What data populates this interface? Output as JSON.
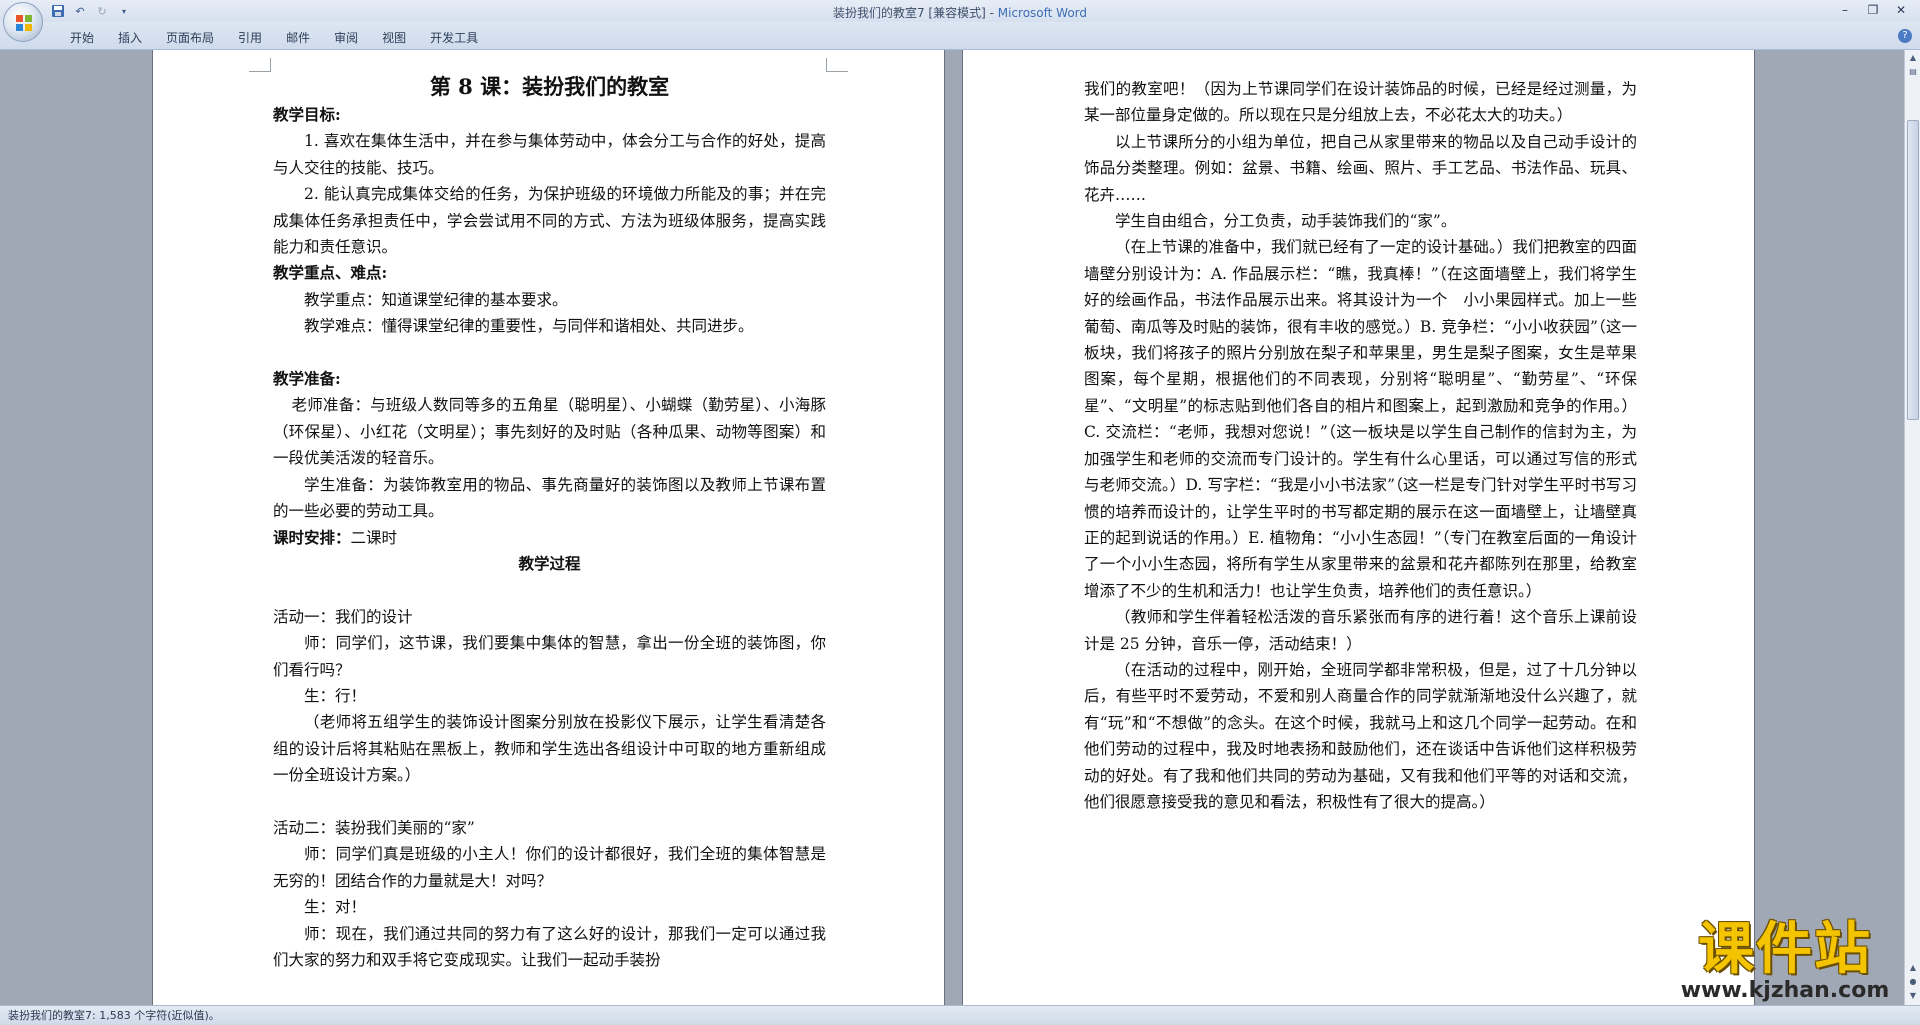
{
  "window": {
    "title_doc": "装扮我们的教室7 [兼容模式] - ",
    "title_app": "Microsoft Word"
  },
  "ribbon": {
    "tabs": [
      "开始",
      "插入",
      "页面布局",
      "引用",
      "邮件",
      "审阅",
      "视图",
      "开发工具"
    ]
  },
  "page1": {
    "title": "第 8 课：装扮我们的教室",
    "paragraphs": [
      {
        "style": "h",
        "text": "教学目标:"
      },
      {
        "style": "ind",
        "text": "1. 喜欢在集体生活中，并在参与集体劳动中，体会分工与合作的好处，提高与人交往的技能、技巧。"
      },
      {
        "style": "ind",
        "text": "2. 能认真完成集体交给的任务，为保护班级的环境做力所能及的事；并在完成集体任务承担责任中，学会尝试用不同的方式、方法为班级体服务，提高实践能力和责任意识。"
      },
      {
        "style": "h",
        "text": "教学重点、难点:"
      },
      {
        "style": "ind",
        "text": "教学重点：知道课堂纪律的基本要求。"
      },
      {
        "style": "ind",
        "text": "教学难点：懂得课堂纪律的重要性，与同伴和谐相处、共同进步。"
      },
      {
        "style": "empty",
        "text": ""
      },
      {
        "style": "h",
        "text": "教学准备:"
      },
      {
        "style": "ind1",
        "text": "老师准备：与班级人数同等多的五角星（聪明星）、小蝴蝶（勤劳星）、小海豚（环保星）、小红花（文明星）；事先刻好的及时贴（各种瓜果、动物等图案）和一段优美活泼的轻音乐。"
      },
      {
        "style": "ind",
        "text": "学生准备：为装饰教室用的物品、事先商量好的装饰图以及教师上节课布置的一些必要的劳动工具。"
      },
      {
        "style": "h2",
        "label": "课时安排：",
        "text": "二课时"
      },
      {
        "style": "center",
        "text": "教学过程"
      },
      {
        "style": "empty",
        "text": ""
      },
      {
        "style": "plain",
        "text": "活动一：我们的设计"
      },
      {
        "style": "ind",
        "text": "师：同学们，这节课，我们要集中集体的智慧，拿出一份全班的装饰图，你们看行吗？"
      },
      {
        "style": "ind",
        "text": "生：行！"
      },
      {
        "style": "ind",
        "text": "（老师将五组学生的装饰设计图案分别放在投影仪下展示，让学生看清楚各组的设计后将其粘贴在黑板上，教师和学生选出各组设计中可取的地方重新组成一份全班设计方案。）"
      },
      {
        "style": "empty",
        "text": ""
      },
      {
        "style": "plain",
        "text": "活动二：装扮我们美丽的“家”"
      },
      {
        "style": "ind",
        "text": "师：同学们真是班级的小主人！你们的设计都很好，我们全班的集体智慧是无穷的！团结合作的力量就是大！对吗？"
      },
      {
        "style": "ind",
        "text": "生：对！"
      },
      {
        "style": "ind",
        "text": "师：现在，我们通过共同的努力有了这么好的设计，那我们一定可以通过我们大家的努力和双手将它变成现实。让我们一起动手装扮"
      }
    ]
  },
  "page2": {
    "paragraphs": [
      {
        "style": "plain",
        "text": "我们的教室吧！（因为上节课同学们在设计装饰品的时候，已经是经过测量，为某一部位量身定做的。所以现在只是分组放上去，不必花太大的功夫。）"
      },
      {
        "style": "ind",
        "text": "以上节课所分的小组为单位，把自己从家里带来的物品以及自己动手设计的饰品分类整理。例如：盆景、书籍、绘画、照片、手工艺品、书法作品、玩具、花卉……"
      },
      {
        "style": "ind",
        "text": "学生自由组合，分工负责，动手装饰我们的“家”。"
      },
      {
        "style": "ind",
        "text": "（在上节课的准备中，我们就已经有了一定的设计基础。）我们把教室的四面墙壁分别设计为：A. 作品展示栏：“瞧，我真棒！”（在这面墙壁上，我们将学生好的绘画作品，书法作品展示出来。将其设计为一个　小小果园样式。加上一些葡萄、南瓜等及时贴的装饰，很有丰收的感觉。）B. 竞争栏：“小小收获园”（这一板块，我们将孩子的照片分别放在梨子和苹果里，男生是梨子图案，女生是苹果图案，每个星期，根据他们的不同表现，分别将“聪明星”、“勤劳星”、“环保星”、“文明星”的标志贴到他们各自的相片和图案上，起到激励和竞争的作用。）C. 交流栏：“老师，我想对您说！”（这一板块是以学生自己制作的信封为主，为加强学生和老师的交流而专门设计的。学生有什么心里话，可以通过写信的形式与老师交流。）D. 写字栏：“我是小小书法家”（这一栏是专门针对学生平时书写习惯的培养而设计的，让学生平时的书写都定期的展示在这一面墙壁上，让墙壁真正的起到说话的作用。）E. 植物角：“小小生态园！”（专门在教室后面的一角设计了一个小小生态园，将所有学生从家里带来的盆景和花卉都陈列在那里，给教室增添了不少的生机和活力！也让学生负责，培养他们的责任意识。）"
      },
      {
        "style": "ind",
        "text": "（教师和学生伴着轻松活泼的音乐紧张而有序的进行着！这个音乐上课前设计是 25 分钟，音乐一停，活动结束！）"
      },
      {
        "style": "ind",
        "text": "（在活动的过程中，刚开始，全班同学都非常积极，但是，过了十几分钟以后，有些平时不爱劳动，不爱和别人商量合作的同学就渐渐地没什么兴趣了，就有“玩”和“不想做”的念头。在这个时候，我就马上和这几个同学一起劳动。在和他们劳动的过程中，我及时地表扬和鼓励他们，还在谈话中告诉他们这样积极劳动的好处。有了我和他们共同的劳动为基础，又有我和他们平等的对话和交流，他们很愿意接受我的意见和看法，积极性有了很大的提高。）"
      },
      {
        "style": "empty",
        "text": ""
      }
    ]
  },
  "status": {
    "text": "装扮我们的教室7: 1,583 个字符(近似值)。"
  },
  "watermark": {
    "big": "课件站",
    "url": "www.kjzhan.com"
  }
}
